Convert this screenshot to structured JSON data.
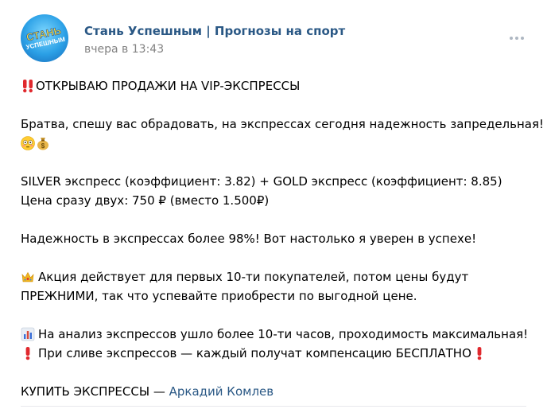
{
  "post": {
    "author": "Стань Успешным | Прогнозы на спорт",
    "date": "вчера в 13:43",
    "avatar": {
      "line1": "СТАНЬ",
      "line2": "УСПЕШНЫМ"
    },
    "more_icon": "more-horizontal-icon",
    "text": {
      "headline": "ОТКРЫВАЮ ПРОДАЖИ НА VIP-ЭКСПРЕССЫ",
      "p1_line1": "Братва, спешу вас обрадовать, на экспрессах сегодня надежность запредельная!",
      "p2_line1": "SILVER экспресс (коэффициент: 3.82) + GOLD экспресс (коэффициент: 8.85)",
      "p2_line2": "Цена сразу двух: 750 ₽ (вместо 1.500₽)",
      "p3_line1": "Надежность в экспрессах более 98%! Вот настолько я уверен в успехе!",
      "p4_line1": "Акция действует для первых 10-ти покупателей, потом цены будут",
      "p4_line2": "ПРЕЖНИМИ, так что успевайте приобрести по выгодной цене.",
      "p5_line1": "На анализ экспрессов ушло более 10-ти часов, проходимость максимальная!",
      "p5_line2": "При сливе экспрессов — каждый получат компенсацию БЕСПЛАТНО",
      "cta_prefix": "КУПИТЬ ЭКСПРЕССЫ — ",
      "cta_link": "Аркадий Комлев"
    },
    "emojis": [
      "double-exclamation-icon",
      "flushed-face-icon",
      "money-bag-icon",
      "crown-icon",
      "bar-chart-icon",
      "exclamation-icon"
    ]
  },
  "colors": {
    "link": "#2a5885",
    "meta": "#828282",
    "accent_red": "#e0282d"
  }
}
